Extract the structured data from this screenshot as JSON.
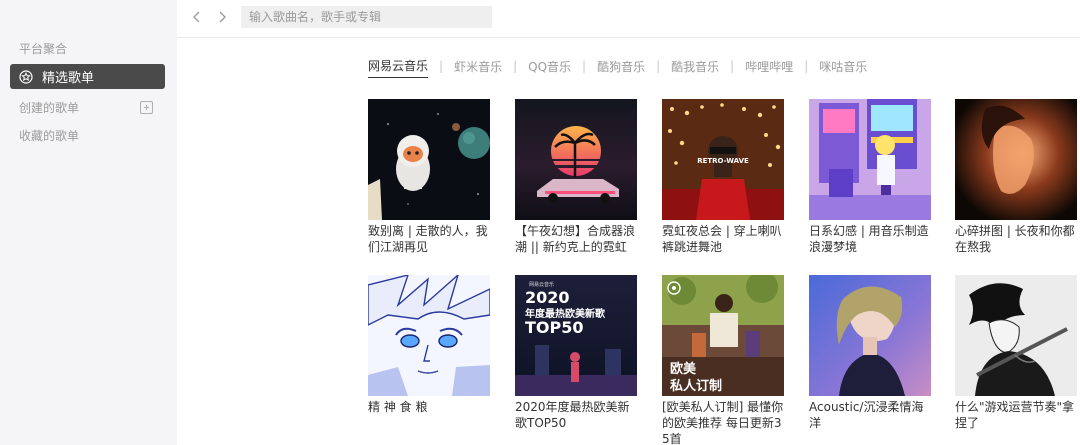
{
  "sidebar": {
    "section_label": "平台聚合",
    "active_item": {
      "label": "精选歌单",
      "icon": "star-circle-icon"
    },
    "created_label": "创建的歌单",
    "collected_label": "收藏的歌单"
  },
  "topbar": {
    "back_icon": "chevron-left-icon",
    "forward_icon": "chevron-right-icon",
    "search_placeholder": "输入歌曲名，歌手或专辑",
    "search_value": ""
  },
  "tabs": [
    {
      "label": "网易云音乐",
      "active": true
    },
    {
      "label": "虾米音乐",
      "active": false
    },
    {
      "label": "QQ音乐",
      "active": false
    },
    {
      "label": "酷狗音乐",
      "active": false
    },
    {
      "label": "酷我音乐",
      "active": false
    },
    {
      "label": "哔哩哔哩",
      "active": false
    },
    {
      "label": "咪咕音乐",
      "active": false
    }
  ],
  "playlists": [
    {
      "title": "致别离 | 走散的人，我们江湖再见"
    },
    {
      "title": "【午夜幻想】合成器浪潮 || 新约克上的霓虹"
    },
    {
      "title": "霓虹夜总会 | 穿上喇叭裤跳进舞池",
      "cover_text": "RETRO-WAVE"
    },
    {
      "title": "日系幻感 | 用音乐制造浪漫梦境"
    },
    {
      "title": "心碎拼图 | 长夜和你都在熬我"
    },
    {
      "title": "精 神 食 粮"
    },
    {
      "title": "2020年度最热欧美新歌TOP50",
      "cover_text": [
        "网易云音乐",
        "2020",
        "年度最热欧美新歌",
        "TOP50"
      ]
    },
    {
      "title": "[欧美私人订制] 最懂你的欧美推荐 每日更新35首",
      "cover_text": [
        "欧美",
        "私人订制"
      ]
    },
    {
      "title": "Acoustic/沉浸柔情海洋"
    },
    {
      "title": "什么\"游戏运营节奏\"拿捏了"
    }
  ]
}
